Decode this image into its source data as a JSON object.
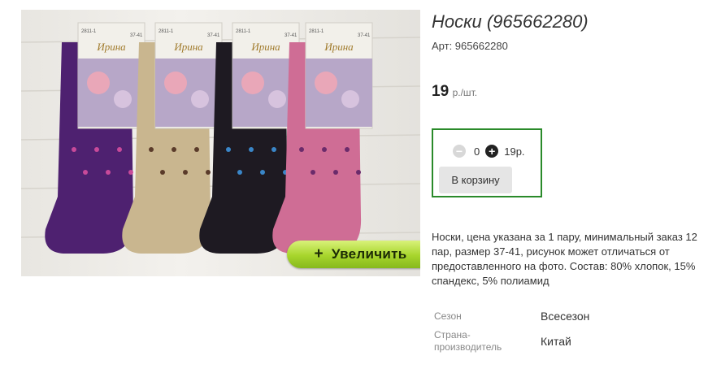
{
  "product": {
    "title": "Носки (965662280)",
    "sku": "Арт: 965662280",
    "price": "19",
    "price_unit": "р./шт.",
    "description": "Носки, цена указана за 1 пару, минимальный заказ 12 пар, размер 37-41, рисунок может отличаться от предоставленного на фото. Состав: 80% хлопок, 15% спандекс, 5% полиамид"
  },
  "photo": {
    "zoom_label": "Увеличить",
    "zoom_icon": "+",
    "brand": "Ирина",
    "label_codes": [
      "2811-1",
      "37-41"
    ],
    "sock_colors": [
      "#4e2170",
      "#c9b68f",
      "#1e1a22",
      "#cf6d95"
    ]
  },
  "cart": {
    "minus_icon": "−",
    "plus_icon": "+",
    "quantity": "0",
    "total": "19р.",
    "button_label": "В корзину",
    "border_color": "#2a8a2a"
  },
  "properties": [
    {
      "label": "Сезон",
      "value": "Всесезон"
    },
    {
      "label": "Страна-производитель",
      "value": "Китай"
    }
  ]
}
